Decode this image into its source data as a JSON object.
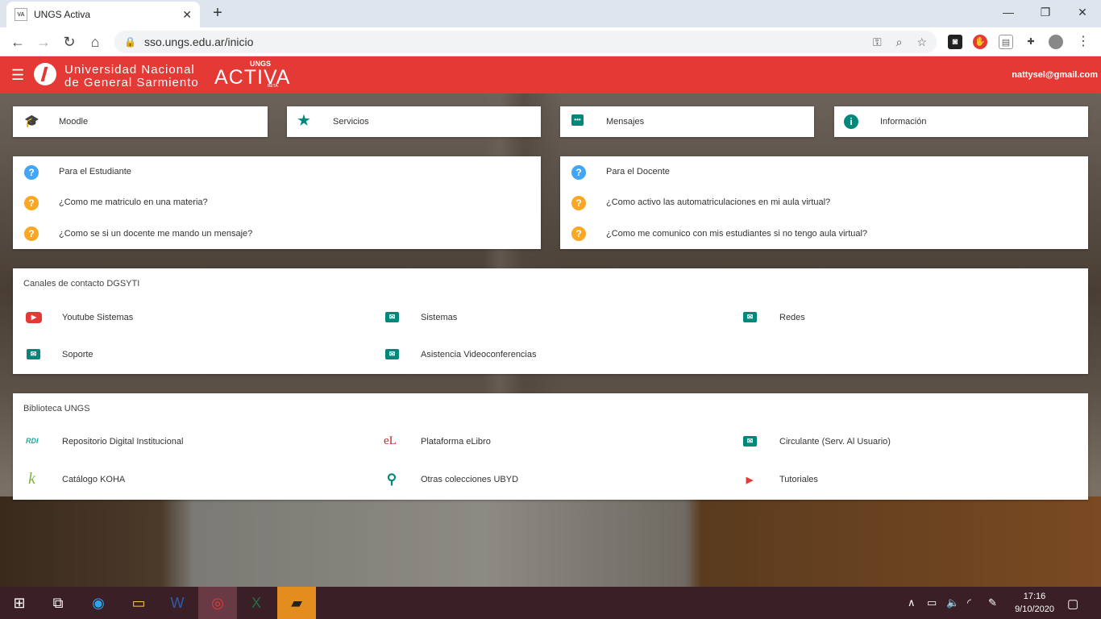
{
  "browser": {
    "tab_title": "UNGS Activa",
    "favicon_text": "VA",
    "url": "sso.ungs.edu.ar/inicio",
    "new_tab": "+",
    "close_tab": "✕"
  },
  "header": {
    "uni_line1": "Universidad Nacional",
    "uni_line2": "de General Sarmiento",
    "activa": "ACTIVA",
    "ungs": "UNGS",
    "beta": "BETA",
    "user_email": "nattysel@gmail.com"
  },
  "top_cards": [
    {
      "label": "Moodle",
      "icon": "graduation-cap-icon"
    },
    {
      "label": "Servicios",
      "icon": "star-icon"
    },
    {
      "label": "Mensajes",
      "icon": "chat-icon"
    },
    {
      "label": "Información",
      "icon": "info-icon"
    }
  ],
  "faq_student": {
    "title": "Para el Estudiante",
    "items": [
      "¿Como me matriculo en una materia?",
      "¿Como se si un docente me mando un mensaje?"
    ]
  },
  "faq_teacher": {
    "title": "Para el Docente",
    "items": [
      "¿Como activo las automatriculaciones en mi aula virtual?",
      "¿Como me comunico con mis estudiantes si no tengo aula virtual?"
    ]
  },
  "contact": {
    "title": "Canales de contacto DGSYTI",
    "items": [
      {
        "label": "Youtube Sistemas",
        "icon": "youtube-icon"
      },
      {
        "label": "Sistemas",
        "icon": "mail-icon"
      },
      {
        "label": "Redes",
        "icon": "mail-icon"
      },
      {
        "label": "Soporte",
        "icon": "mail-icon"
      },
      {
        "label": "Asistencia Videoconferencias",
        "icon": "mail-icon"
      }
    ]
  },
  "library": {
    "title": "Biblioteca UNGS",
    "items": [
      {
        "label": "Repositorio Digital Institucional",
        "icon_text": "RDI"
      },
      {
        "label": "Plataforma eLibro",
        "icon_text": "eL"
      },
      {
        "label": "Circulante (Serv. Al Usuario)",
        "icon": "mail-icon"
      },
      {
        "label": "Catálogo KOHA",
        "icon_text": "k"
      },
      {
        "label": "Otras colecciones UBYD",
        "icon": "search-icon"
      },
      {
        "label": "Tutoriales",
        "icon": "play-icon"
      }
    ]
  },
  "taskbar": {
    "time": "17:16",
    "date": "9/10/2020"
  },
  "colors": {
    "brand_red": "#e53935",
    "teal": "#00897b",
    "help_blue": "#42a5f5",
    "help_orange": "#f9a825"
  }
}
